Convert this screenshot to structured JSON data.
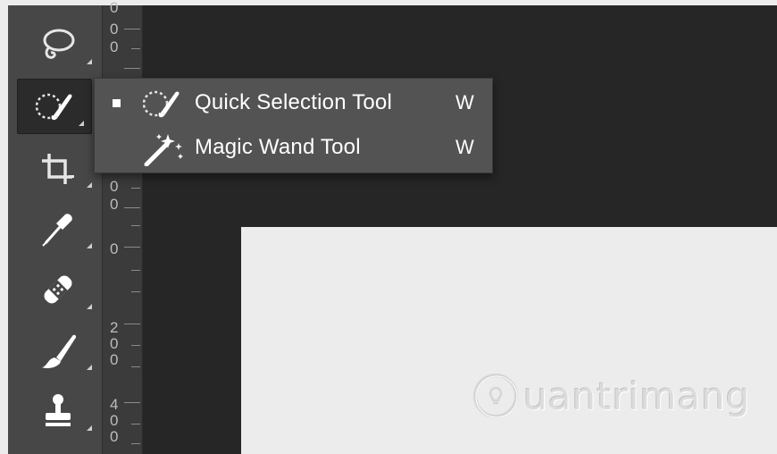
{
  "toolbar": {
    "tools": [
      {
        "name": "lasso-tool-icon"
      },
      {
        "name": "quick-selection-tool-icon",
        "active": true
      },
      {
        "name": "crop-tool-icon"
      },
      {
        "name": "eyedropper-tool-icon"
      },
      {
        "name": "healing-brush-tool-icon"
      },
      {
        "name": "brush-tool-icon"
      },
      {
        "name": "clone-stamp-tool-icon"
      }
    ]
  },
  "ruler": {
    "labels": [
      "0\n0",
      "0\n0",
      "0",
      "2\n0\n0",
      "4\n0\n0"
    ]
  },
  "flyout": {
    "items": [
      {
        "label": "Quick Selection Tool",
        "shortcut": "W",
        "selected": true,
        "icon": "quick-selection-icon"
      },
      {
        "label": "Magic Wand Tool",
        "shortcut": "W",
        "selected": false,
        "icon": "magic-wand-icon"
      }
    ]
  },
  "watermark": {
    "text": "uantrimang",
    "icon": "lightbulb-icon"
  },
  "colors": {
    "background": "#262626",
    "toolbar": "#474747",
    "flyout": "#535353",
    "paper": "#ececec"
  }
}
